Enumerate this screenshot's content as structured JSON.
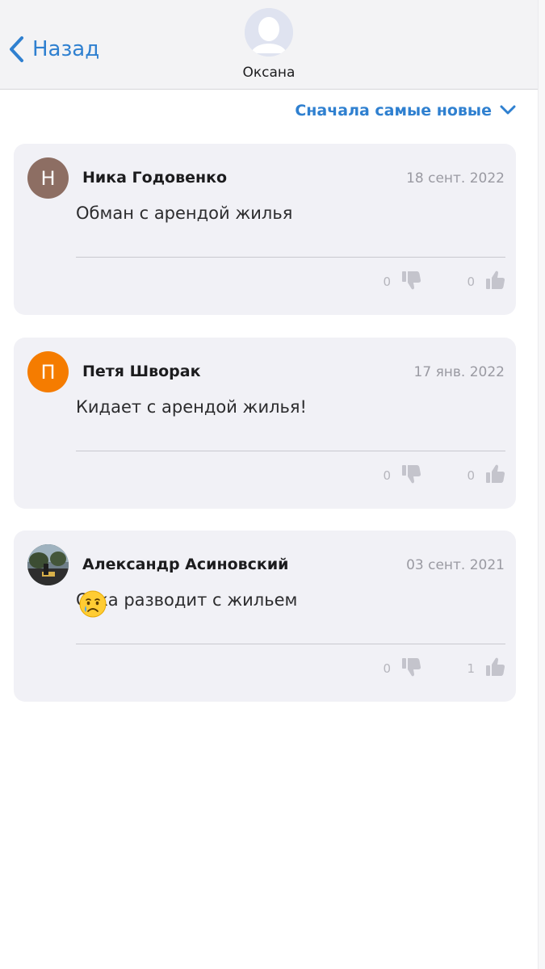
{
  "header": {
    "back_label": "Назад",
    "profile_name": "Оксана"
  },
  "sort": {
    "label": "Сначала самые новые"
  },
  "colors": {
    "accent": "#2f80d0",
    "card_bg": "#f1f1f6",
    "icon_gray": "#c4c4cc"
  },
  "reviews": [
    {
      "initial": "Н",
      "avatar_color": "#8d6e63",
      "name": "Ника Годовенко",
      "date": "18 сент. 2022",
      "text": "Обман с арендой жилья",
      "dislikes": "0",
      "likes": "0"
    },
    {
      "initial": "П",
      "avatar_color": "#f57c00",
      "name": "Петя Шворак",
      "date": "17 янв. 2022",
      "text": "Кидает с арендой жилья!",
      "dislikes": "0",
      "likes": "0"
    },
    {
      "initial": "",
      "avatar_color": "#4a5a3a",
      "name": "Александр Асиновский",
      "date": "03 сент. 2021",
      "text": "Сука разводит с жильем",
      "dislikes": "0",
      "likes": "1"
    }
  ]
}
